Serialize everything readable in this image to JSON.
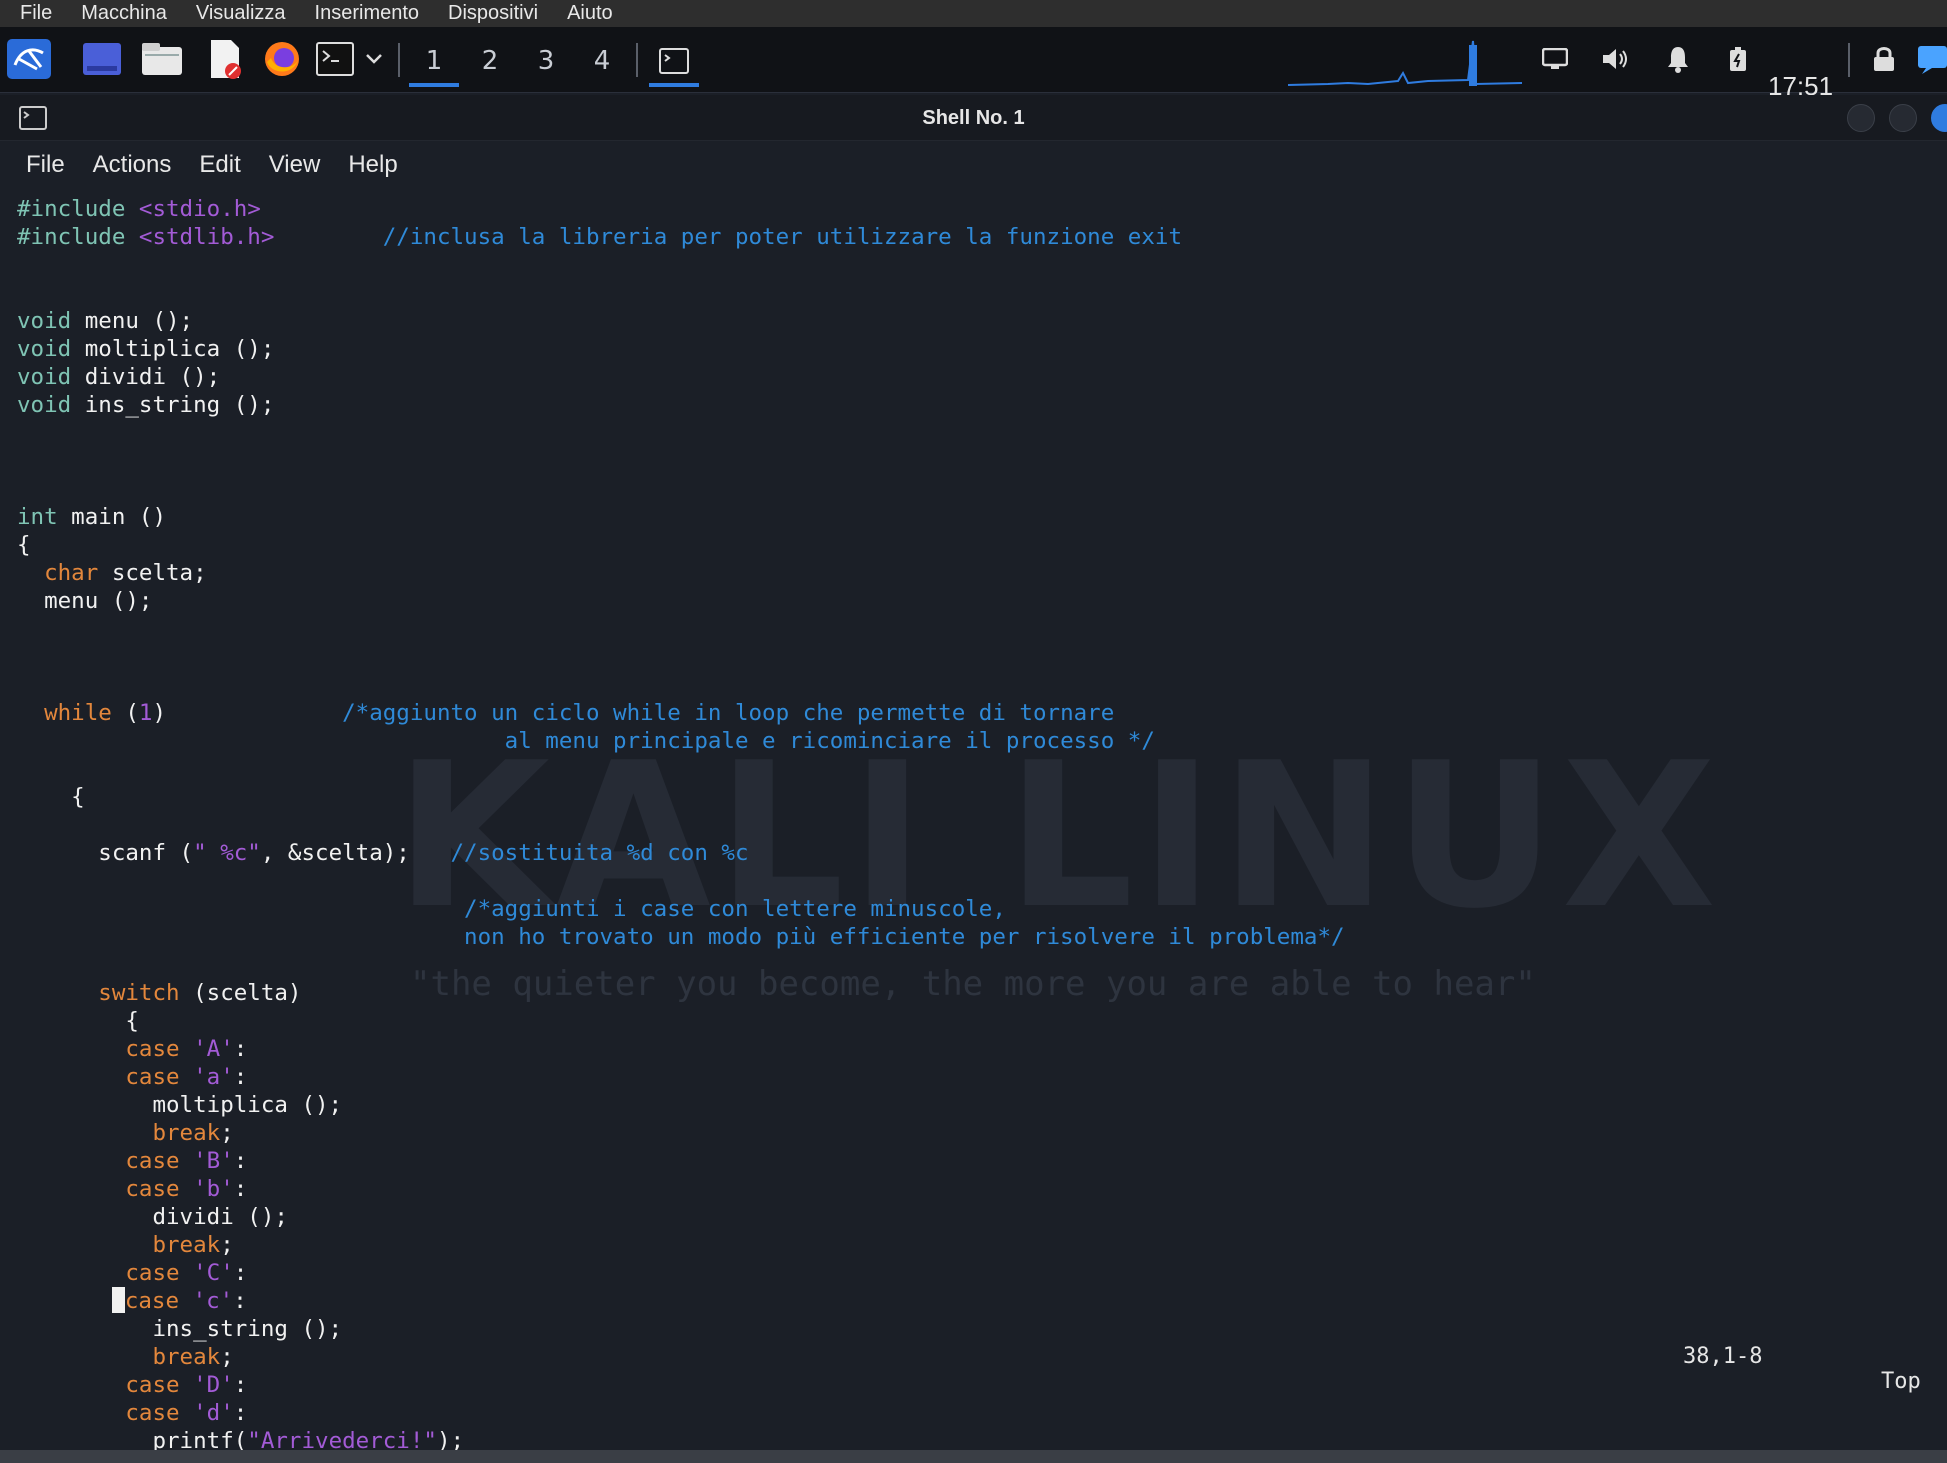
{
  "vm_menu": [
    "File",
    "Macchina",
    "Visualizza",
    "Inserimento",
    "Dispositivi",
    "Aiuto"
  ],
  "panel": {
    "workspaces": [
      "1",
      "2",
      "3",
      "4"
    ],
    "active_workspace": "1",
    "clock": "17:51",
    "accent": "#2f7ce0"
  },
  "window": {
    "title": "Shell No. 1"
  },
  "terminal_menu": [
    "File",
    "Actions",
    "Edit",
    "View",
    "Help"
  ],
  "wallpaper": {
    "logo": "KALI LINUX",
    "quote": "\"the quieter you become, the more you are able to hear\""
  },
  "code_lines": [
    [
      [
        "#include ",
        "kw"
      ],
      [
        "<stdio.h>",
        "str"
      ]
    ],
    [
      [
        "#include ",
        "kw"
      ],
      [
        "<stdlib.h>",
        "str"
      ],
      [
        "        ",
        "txt"
      ],
      [
        "//inclusa la libreria per poter utilizzare la funzione exit",
        "cmt"
      ]
    ],
    [],
    [],
    [
      [
        "void",
        "kw"
      ],
      [
        " menu ();",
        "txt"
      ]
    ],
    [
      [
        "void",
        "kw"
      ],
      [
        " moltiplica ();",
        "txt"
      ]
    ],
    [
      [
        "void",
        "kw"
      ],
      [
        " dividi ();",
        "txt"
      ]
    ],
    [
      [
        "void",
        "kw"
      ],
      [
        " ins_string ();",
        "txt"
      ]
    ],
    [],
    [],
    [],
    [
      [
        "int",
        "kw"
      ],
      [
        " main ()",
        "txt"
      ]
    ],
    [
      [
        "{",
        "txt"
      ]
    ],
    [
      [
        "  ",
        "txt"
      ],
      [
        "char",
        "kw2"
      ],
      [
        " scelta;",
        "txt"
      ]
    ],
    [
      [
        "  menu ();",
        "txt"
      ]
    ],
    [],
    [],
    [],
    [
      [
        "  ",
        "txt"
      ],
      [
        "while",
        "kw2"
      ],
      [
        " (",
        "txt"
      ],
      [
        "1",
        "str"
      ],
      [
        ")",
        "txt"
      ],
      [
        "             ",
        "txt"
      ],
      [
        "/*aggiunto un ciclo while in loop che permette di tornare",
        "cmt"
      ]
    ],
    [
      [
        "                                    ",
        "txt"
      ],
      [
        "al menu principale e ricominciare il processo */",
        "cmt"
      ]
    ],
    [],
    [
      [
        "    {",
        "txt"
      ]
    ],
    [],
    [
      [
        "      scanf (",
        "txt"
      ],
      [
        "\" %c\"",
        "str"
      ],
      [
        ", &scelta);   ",
        "txt"
      ],
      [
        "//sostituita %d con %c",
        "cmt"
      ]
    ],
    [],
    [
      [
        "                                 ",
        "txt"
      ],
      [
        "/*aggiunti i case con lettere minuscole,",
        "cmt"
      ]
    ],
    [
      [
        "                                 ",
        "txt"
      ],
      [
        "non ho trovato un modo più efficiente per risolvere il problema*/",
        "cmt"
      ]
    ],
    [],
    [
      [
        "      ",
        "txt"
      ],
      [
        "switch",
        "kw2"
      ],
      [
        " (scelta)",
        "txt"
      ]
    ],
    [
      [
        "        {",
        "txt"
      ]
    ],
    [
      [
        "        ",
        "txt"
      ],
      [
        "case",
        "kw2"
      ],
      [
        " ",
        "txt"
      ],
      [
        "'A'",
        "str"
      ],
      [
        ":",
        "txt"
      ]
    ],
    [
      [
        "        ",
        "txt"
      ],
      [
        "case",
        "kw2"
      ],
      [
        " ",
        "txt"
      ],
      [
        "'a'",
        "str"
      ],
      [
        ":",
        "txt"
      ]
    ],
    [
      [
        "          moltiplica ();",
        "txt"
      ]
    ],
    [
      [
        "          ",
        "txt"
      ],
      [
        "break",
        "kw2"
      ],
      [
        ";",
        "txt"
      ]
    ],
    [
      [
        "        ",
        "txt"
      ],
      [
        "case",
        "kw2"
      ],
      [
        " ",
        "txt"
      ],
      [
        "'B'",
        "str"
      ],
      [
        ":",
        "txt"
      ]
    ],
    [
      [
        "        ",
        "txt"
      ],
      [
        "case",
        "kw2"
      ],
      [
        " ",
        "txt"
      ],
      [
        "'b'",
        "str"
      ],
      [
        ":",
        "txt"
      ]
    ],
    [
      [
        "          dividi ();",
        "txt"
      ]
    ],
    [
      [
        "          ",
        "txt"
      ],
      [
        "break",
        "kw2"
      ],
      [
        ";",
        "txt"
      ]
    ],
    [
      [
        "        ",
        "txt"
      ],
      [
        "case",
        "kw2"
      ],
      [
        " ",
        "txt"
      ],
      [
        "'C'",
        "str"
      ],
      [
        ":",
        "txt"
      ]
    ],
    [
      [
        "       ",
        "txt"
      ],
      [
        "",
        "cursor"
      ],
      [
        "case",
        "kw2"
      ],
      [
        " ",
        "txt"
      ],
      [
        "'c'",
        "str"
      ],
      [
        ":",
        "txt"
      ]
    ],
    [
      [
        "          ins_string ();",
        "txt"
      ]
    ],
    [
      [
        "          ",
        "txt"
      ],
      [
        "break",
        "kw2"
      ],
      [
        ";",
        "txt"
      ]
    ],
    [
      [
        "        ",
        "txt"
      ],
      [
        "case",
        "kw2"
      ],
      [
        " ",
        "txt"
      ],
      [
        "'D'",
        "str"
      ],
      [
        ":",
        "txt"
      ]
    ],
    [
      [
        "        ",
        "txt"
      ],
      [
        "case",
        "kw2"
      ],
      [
        " ",
        "txt"
      ],
      [
        "'d'",
        "str"
      ],
      [
        ":",
        "txt"
      ]
    ],
    [
      [
        "          printf(",
        "txt"
      ],
      [
        "\"Arrivederci!\"",
        "str"
      ],
      [
        ");",
        "txt"
      ]
    ]
  ],
  "statusbar": {
    "position": "38,1-8",
    "scroll": "Top"
  }
}
